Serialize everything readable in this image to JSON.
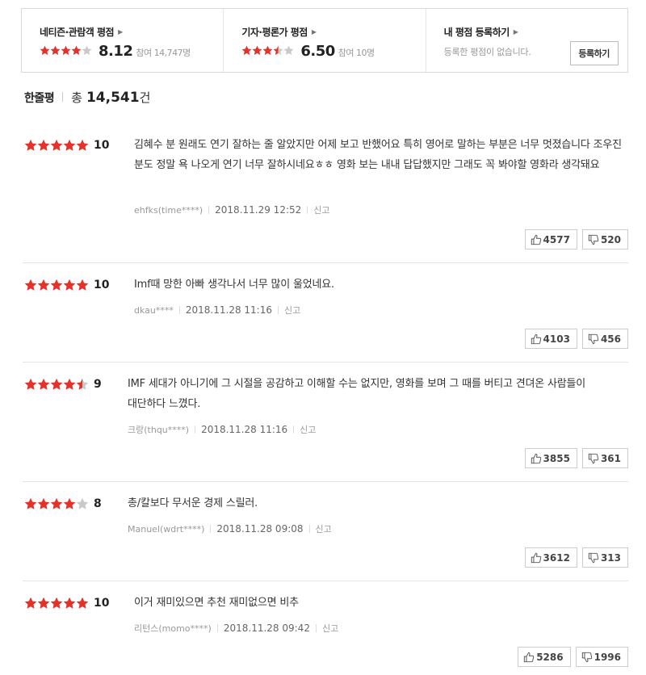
{
  "summary": {
    "netizen": {
      "title": "네티즌·관람객 평점",
      "stars": 4,
      "score": "8.12",
      "count": "참여 14,747명"
    },
    "critic": {
      "title": "기자·평론가 평점",
      "stars": 3.5,
      "score": "6.50",
      "count": "참여 10명"
    },
    "my": {
      "title": "내 평점 등록하기",
      "desc": "등록한 평점이 없습니다.",
      "button": "등록하기"
    }
  },
  "header": {
    "title": "한줄평",
    "total_label": "총",
    "total": "14,541",
    "unit": "건"
  },
  "colors": {
    "star_on": "#e4322a",
    "star_off": "#c9c9c9"
  },
  "reviews": [
    {
      "stars": 5,
      "score": "10",
      "text": "김혜수 분 원래도 연기 잘하는 줄 알았지만 어제 보고 반했어요 특히 영어로 말하는 부분은 너무 멋졌습니다 조우진 분도 정말 욕 나오게 연기 너무 잘하시네요ㅎㅎ 영화 보는 내내 답답했지만 그래도 꼭 봐야할 영화라 생각돼요",
      "author": "ehfks(time****)",
      "date": "2018.11.29 12:52",
      "report": "신고",
      "up": "4577",
      "down": "520"
    },
    {
      "stars": 5,
      "score": "10",
      "text": "Imf때 망한 아빠 생각나서 너무 많이 울었네요.",
      "author": "dkau****",
      "date": "2018.11.28 11:16",
      "report": "신고",
      "up": "4103",
      "down": "456"
    },
    {
      "stars": 4.5,
      "score": "9",
      "text": "IMF 세대가 아니기에 그 시절을 공감하고 이해할 수는 없지만, 영화를 보며 그 때를 버티고 견뎌온 사람들이 대단하다 느꼈다.",
      "author": "크랑(thqu****)",
      "date": "2018.11.28 11:16",
      "report": "신고",
      "up": "3855",
      "down": "361"
    },
    {
      "stars": 4,
      "score": "8",
      "text": "총/칼보다 무서운 경제 스릴러.",
      "author": "Manuel(wdrt****)",
      "date": "2018.11.28 09:08",
      "report": "신고",
      "up": "3612",
      "down": "313"
    },
    {
      "stars": 5,
      "score": "10",
      "text": "이거 재미있으면 추천 재미없으면 비추",
      "author": "리턴스(momo****)",
      "date": "2018.11.28 09:42",
      "report": "신고",
      "up": "5286",
      "down": "1996"
    }
  ]
}
